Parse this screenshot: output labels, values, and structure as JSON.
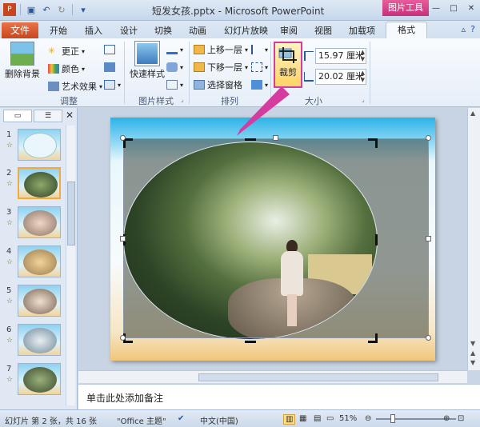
{
  "window": {
    "title": "短发女孩.pptx - Microsoft PowerPoint",
    "context_tools_label": "图片工具",
    "controls": [
      "—",
      "□",
      "✕"
    ]
  },
  "tabs": {
    "file": "文件",
    "items": [
      "开始",
      "插入",
      "设计",
      "切换",
      "动画",
      "幻灯片放映",
      "审阅",
      "视图",
      "加载项"
    ],
    "active": "格式"
  },
  "ribbon": {
    "remove_bg": "删除背景",
    "corrections": "更正",
    "color": "颜色",
    "artistic": "艺术效果",
    "group_adjust": "调整",
    "quick_styles": "快速样式",
    "group_pic_styles": "图片样式",
    "bring_forward": "上移一层",
    "send_backward": "下移一层",
    "selection_pane": "选择窗格",
    "group_arrange": "排列",
    "crop": "裁剪",
    "height": "15.97 厘米",
    "width": "20.02 厘米",
    "group_size": "大小"
  },
  "slides_pane": {
    "numbers": [
      "1",
      "2",
      "3",
      "4",
      "5",
      "6",
      "7"
    ],
    "selected": "2"
  },
  "notes": {
    "placeholder": "单击此处添加备注"
  },
  "status": {
    "slide_info": "幻灯片 第 2 张，共 16 张",
    "theme": "\"Office 主题\"",
    "language": "中文(中国)",
    "zoom": "51%"
  },
  "colors": {
    "accent_pink": "#d53ca0",
    "file_tab": "#c9461c"
  }
}
